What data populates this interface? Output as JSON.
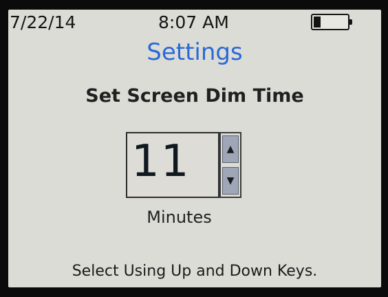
{
  "status_bar": {
    "date": "7/22/14",
    "time": "8:07 AM",
    "battery_icon": "battery-icon",
    "battery_level": 0.2
  },
  "screen_title": "Settings",
  "setting": {
    "heading": "Set Screen Dim Time",
    "value": "11",
    "unit": "Minutes",
    "up_icon": "arrow-up-icon",
    "down_icon": "arrow-down-icon"
  },
  "hint": "Select Using Up and Down Keys.",
  "colors": {
    "title": "#2a69d6",
    "screen_background": "#dcdcd6",
    "stepper_button": "#9ea6b8"
  }
}
